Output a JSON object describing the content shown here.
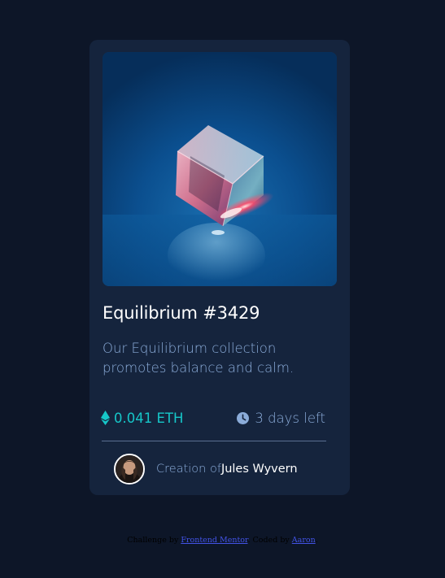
{
  "card": {
    "title": "Equilibrium #3429",
    "description": "Our Equilibrium collection promotes balance and calm.",
    "price": "0.041 ETH",
    "time_left": "3 days left",
    "creator_prefix": "Creation of",
    "creator_name": "Jules Wyvern"
  },
  "icons": {
    "eth": "ethereum-icon",
    "clock": "clock-icon",
    "avatar": "avatar"
  },
  "attribution": {
    "prefix": "Challenge by",
    "link1": "Frontend Mentor",
    "middle": ". Coded by",
    "link2": "Aaron",
    "suffix": "."
  },
  "colors": {
    "page_bg": "#0d1628",
    "card_bg": "#15243d",
    "accent_cyan": "#16c7c9",
    "soft_blue": "#8bacd9",
    "white": "#ffffff",
    "link": "#4253e6"
  }
}
